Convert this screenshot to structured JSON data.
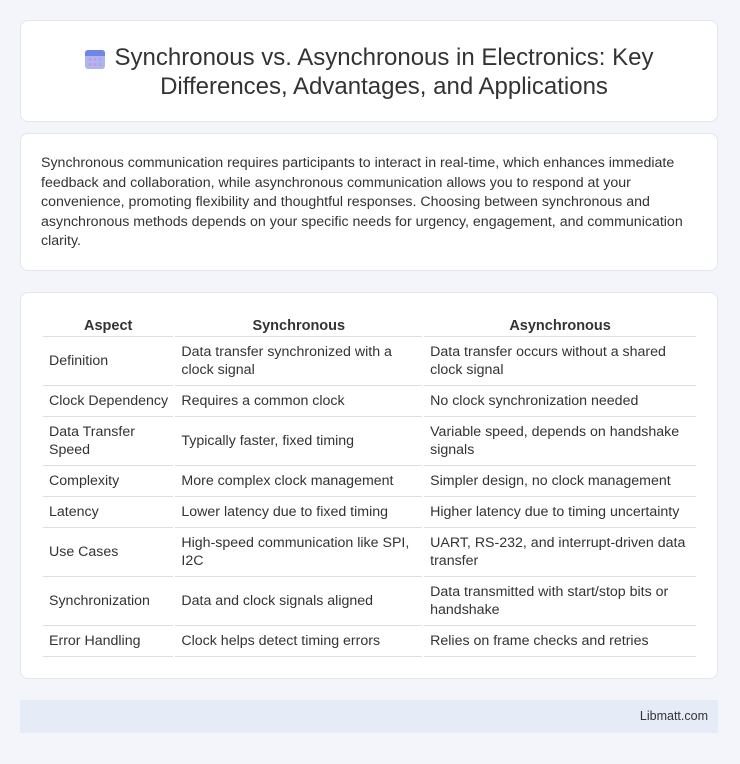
{
  "header": {
    "icon": "calendar-icon",
    "title": "Synchronous vs. Asynchronous in Electronics: Key Differences, Advantages, and Applications"
  },
  "intro": {
    "text": "Synchronous communication requires participants to interact in real-time, which enhances immediate feedback and collaboration, while asynchronous communication allows you to respond at your convenience, promoting flexibility and thoughtful responses. Choosing between synchronous and asynchronous methods depends on your specific needs for urgency, engagement, and communication clarity."
  },
  "table": {
    "headers": [
      "Aspect",
      "Synchronous",
      "Asynchronous"
    ],
    "rows": [
      [
        "Definition",
        "Data transfer synchronized with a clock signal",
        "Data transfer occurs without a shared clock signal"
      ],
      [
        "Clock Dependency",
        "Requires a common clock",
        "No clock synchronization needed"
      ],
      [
        "Data Transfer Speed",
        "Typically faster, fixed timing",
        "Variable speed, depends on handshake signals"
      ],
      [
        "Complexity",
        "More complex clock management",
        "Simpler design, no clock management"
      ],
      [
        "Latency",
        "Lower latency due to fixed timing",
        "Higher latency due to timing uncertainty"
      ],
      [
        "Use Cases",
        "High-speed communication like SPI, I2C",
        "UART, RS-232, and interrupt-driven data transfer"
      ],
      [
        "Synchronization",
        "Data and clock signals aligned",
        "Data transmitted with start/stop bits or handshake"
      ],
      [
        "Error Handling",
        "Clock helps detect timing errors",
        "Relies on frame checks and retries"
      ]
    ]
  },
  "footer": {
    "brand": "Libmatt.com"
  }
}
